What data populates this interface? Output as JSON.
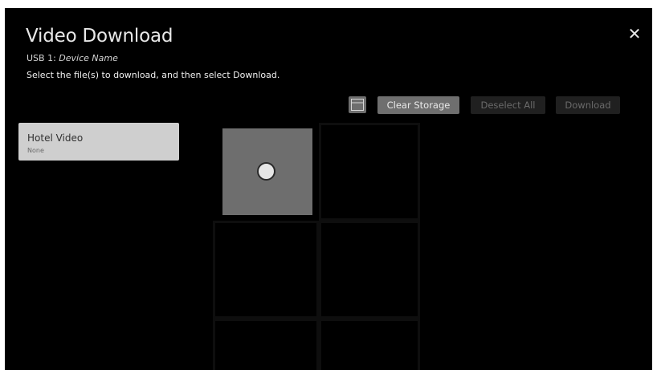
{
  "header": {
    "title": "Video Download",
    "device_prefix": "USB 1: ",
    "device_name": "Device Name",
    "instruction": "Select the file(s) to download, and then select Download.",
    "close_glyph": "✕"
  },
  "toolbar": {
    "view_toggle_icon": "thumbnail-view-icon",
    "clear_storage_label": "Clear Storage",
    "deselect_all_label": "Deselect All",
    "download_label": "Download",
    "deselect_all_enabled": false,
    "download_enabled": false
  },
  "sidebar": {
    "items": [
      {
        "name": "Hotel Video",
        "subtitle": "None",
        "focused": true
      }
    ]
  },
  "grid": {
    "tiles": [
      {
        "selected": true,
        "icon": "selection-circle-icon"
      },
      {
        "selected": false
      },
      {
        "selected": false
      },
      {
        "selected": false
      },
      {
        "selected": false
      },
      {
        "selected": false
      }
    ]
  },
  "colors": {
    "background": "#000000",
    "focused_item": "#cfcfcf",
    "primary_button": "#6f6f6f",
    "disabled_button": "#202020",
    "selected_tile": "#6e6e6e"
  }
}
